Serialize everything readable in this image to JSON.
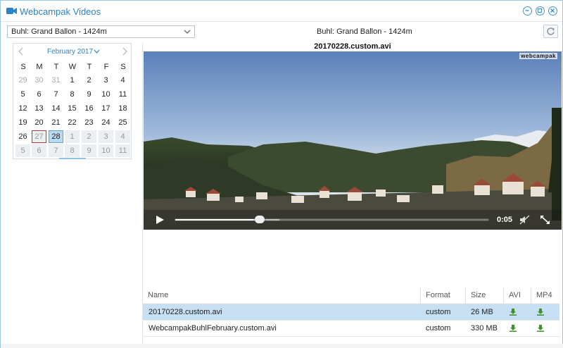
{
  "window": {
    "title": "Webcampak Videos",
    "accent": "#2a82c9"
  },
  "toolbar": {
    "source_value": "Buhl: Grand Ballon - 1424m",
    "location_label": "Buhl: Grand Ballon - 1424m"
  },
  "calendar": {
    "month_label": "February 2017",
    "weekdays": [
      "S",
      "M",
      "T",
      "W",
      "T",
      "F",
      "S"
    ],
    "weeks": [
      [
        "29",
        "30",
        "31",
        "1",
        "2",
        "3",
        "4"
      ],
      [
        "5",
        "6",
        "7",
        "8",
        "9",
        "10",
        "11"
      ],
      [
        "12",
        "13",
        "14",
        "15",
        "16",
        "17",
        "18"
      ],
      [
        "19",
        "20",
        "21",
        "22",
        "23",
        "24",
        "25"
      ],
      [
        "26",
        "27",
        "28",
        "1",
        "2",
        "3",
        "4"
      ],
      [
        "5",
        "6",
        "7",
        "8",
        "9",
        "10",
        "11"
      ]
    ],
    "today": "27",
    "selected": "28"
  },
  "player": {
    "video_title": "20170228.custom.avi",
    "watermark": "webcampak",
    "time": "0:05",
    "progress": 0.27,
    "buffered": 0.33
  },
  "files": {
    "headers": [
      "Name",
      "Format",
      "Size",
      "AVI",
      "MP4"
    ],
    "rows": [
      {
        "name": "20170228.custom.avi",
        "format": "custom",
        "size": "26 MB"
      },
      {
        "name": "WebcampakBuhlFebruary.custom.avi",
        "format": "custom",
        "size": "330 MB"
      }
    ]
  }
}
